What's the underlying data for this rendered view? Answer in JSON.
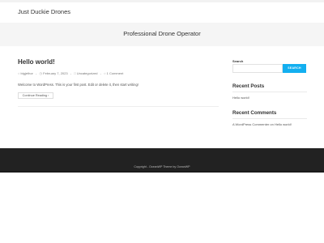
{
  "header": {
    "site_title": "Just Duckie Drones"
  },
  "banner": {
    "text": "Professional Drone Operator"
  },
  "post": {
    "title": "Hello world!",
    "meta": {
      "author": "bigjethor",
      "date": "February 7, 2023",
      "category": "Uncategorized",
      "comments": "1 Comment"
    },
    "excerpt": "Welcome to WordPress. This is your first post. Edit or delete it, then start writing!",
    "button_label": "Continue Reading"
  },
  "sidebar": {
    "search_label": "Search",
    "search_button": "SEARCH",
    "recent_posts_title": "Recent Posts",
    "recent_posts": [
      "Hello world!"
    ],
    "recent_comments_title": "Recent Comments",
    "recent_comment": "A WordPress Commenter on Hello world!"
  },
  "footer": {
    "copyright": "Copyright - OceanWP Theme by OceanWP"
  },
  "colors": {
    "accent": "#13aff0",
    "footer_bg": "#222222",
    "banner_bg": "#f5f5f5"
  }
}
